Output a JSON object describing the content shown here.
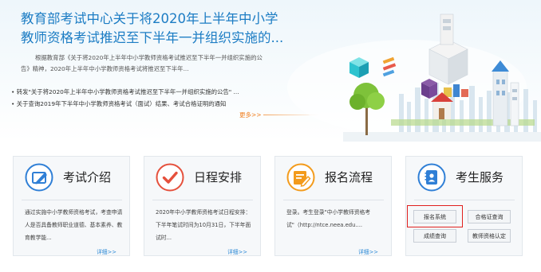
{
  "banner": {
    "headline": "教育部考试中心关于将2020年上半年中小学教师资格考试推迟至下半年一并组织实施的...",
    "summary": "根据教育部《关于将2020年上半年中小学教师资格考试推迟至下半年一并组织实施的公告》精神，2020年上半年中小学教师资格考试将推迟至下半年...",
    "news": [
      "• 转发\"关于将2020年上半年中小学教师资格考试推迟至下半年一并组织实施的公告\" ...",
      "• 关于查询2019年下半年中小学教师资格考试（面试）结果、考试合格证明的通知"
    ],
    "more_label": "更多>>"
  },
  "cards": [
    {
      "title": "考试介绍",
      "body": "通过实施中小学教师资格考试，考查申请人是否具备教师职业道德、基本素养、教育教学能...",
      "more_label": "详细>>"
    },
    {
      "title": "日程安排",
      "body": "2020年中小学教师资格考试日程安排：下半年笔试时间为10月31日，下半年面试时...",
      "more_label": "详细>>"
    },
    {
      "title": "报名流程",
      "body": "登录。考生登录\"中小学教师资格考试\"（http://ntce.neea.edu....",
      "more_label": "详细>>"
    },
    {
      "title": "考生服务",
      "buttons": [
        "报名系统",
        "合格证查询",
        "成绩查询",
        "教师资格认定"
      ]
    }
  ],
  "colors": {
    "accent": "#1d7dc4",
    "more_orange": "#f07d1c",
    "highlight_red": "#e0201e",
    "icon_blue": "#2f7fd6",
    "icon_red": "#e5503c",
    "icon_orange": "#f39b1c"
  },
  "icons": [
    "pencil-icon",
    "checkmark-icon",
    "form-edit-icon",
    "address-book-icon"
  ]
}
